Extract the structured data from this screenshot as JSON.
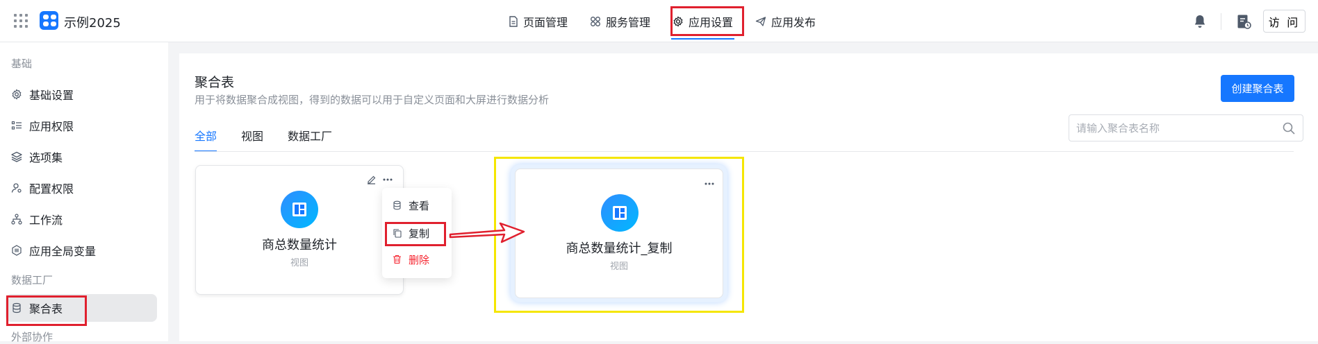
{
  "app": {
    "title": "示例2025"
  },
  "nav": {
    "items": [
      {
        "label": "页面管理"
      },
      {
        "label": "服务管理"
      },
      {
        "label": "应用设置"
      },
      {
        "label": "应用发布"
      }
    ]
  },
  "header_right": {
    "visit_label": "访 问"
  },
  "sidebar": {
    "section_basic": "基础",
    "items": [
      {
        "label": "基础设置"
      },
      {
        "label": "应用权限"
      },
      {
        "label": "选项集"
      },
      {
        "label": "配置权限"
      },
      {
        "label": "工作流"
      },
      {
        "label": "应用全局变量"
      }
    ],
    "section_data": "数据工厂",
    "data_items": [
      {
        "label": "聚合表"
      }
    ],
    "section_external": "外部协作"
  },
  "main": {
    "title": "聚合表",
    "subtitle": "用于将数据聚合成视图，得到的数据可以用于自定义页面和大屏进行数据分析",
    "create_label": "创建聚合表",
    "tabs": [
      {
        "label": "全部"
      },
      {
        "label": "视图"
      },
      {
        "label": "数据工厂"
      }
    ],
    "search_placeholder": "请输入聚合表名称"
  },
  "cards": [
    {
      "name": "商总数量统计",
      "type": "视图"
    },
    {
      "name": "商总数量统计_复制",
      "type": "视图"
    }
  ],
  "context_menu": {
    "items": [
      {
        "label": "查看"
      },
      {
        "label": "复制"
      },
      {
        "label": "删除"
      }
    ]
  },
  "colors": {
    "accent": "#1677ff",
    "danger": "#f5222d",
    "highlight_red": "#e0202e",
    "highlight_yellow": "#f5e600"
  }
}
